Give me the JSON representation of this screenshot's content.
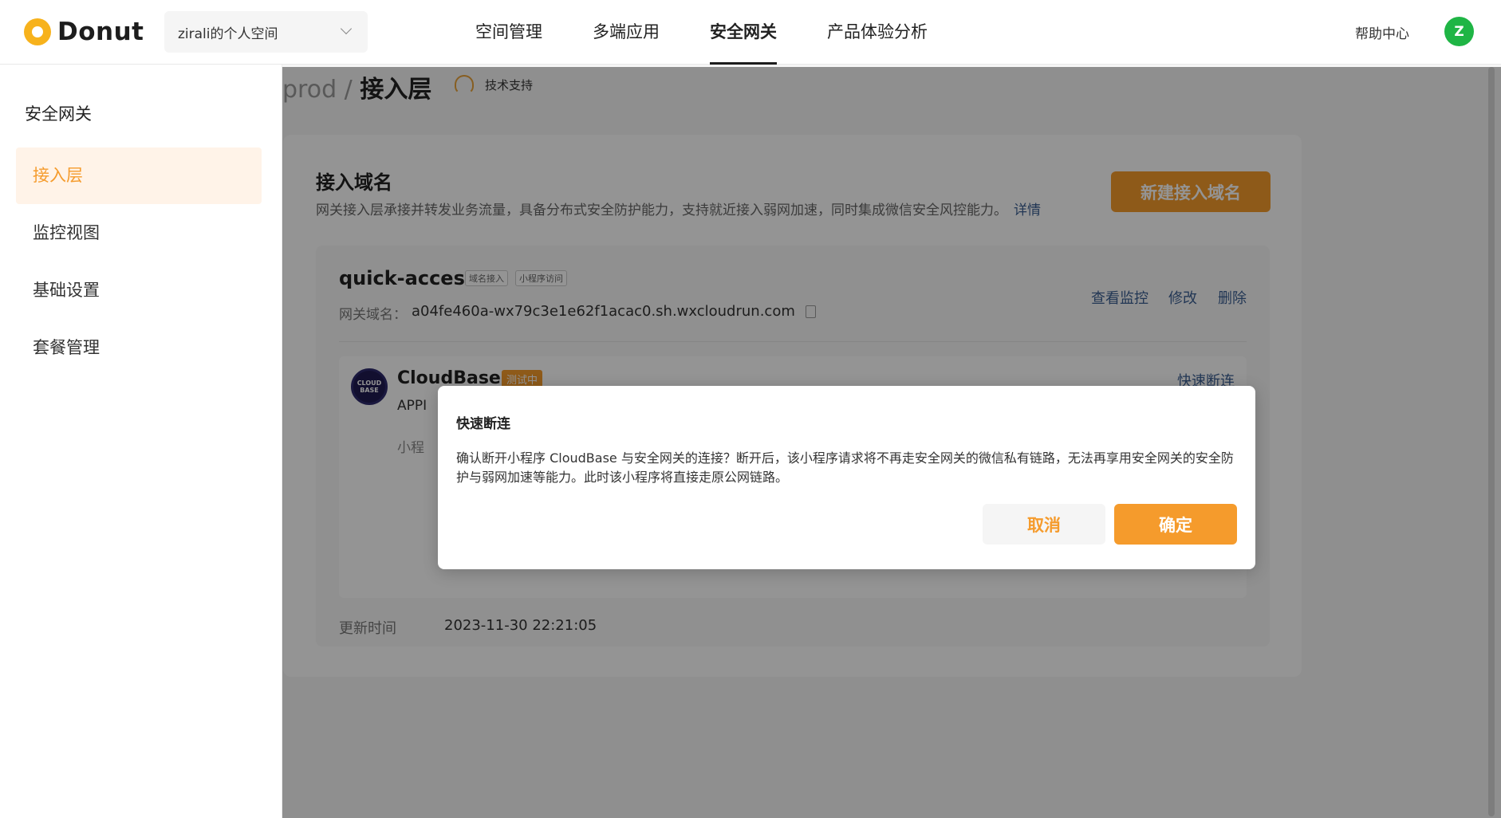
{
  "brand": {
    "name": "Donut",
    "accent": "#f59b2c"
  },
  "space_select": {
    "value": "zirali的个人空间"
  },
  "nav": {
    "items": [
      {
        "label": "空间管理"
      },
      {
        "label": "多端应用"
      },
      {
        "label": "安全网关"
      },
      {
        "label": "产品体验分析"
      }
    ],
    "active": "安全网关"
  },
  "header_right": {
    "help": "帮助中心",
    "avatar_initial": "Z"
  },
  "sidebar": {
    "title": "安全网关",
    "items": [
      {
        "label": "接入层"
      },
      {
        "label": "监控视图"
      },
      {
        "label": "基础设置"
      },
      {
        "label": "套餐管理"
      }
    ],
    "active": "接入层"
  },
  "breadcrumb": {
    "parent": "prod",
    "sep": "/",
    "current": "接入层"
  },
  "support": {
    "label": "技术支持"
  },
  "card": {
    "title": "接入域名",
    "desc": "网关接入层承接并转发业务流量，具备分布式安全防护能力，支持就近接入弱网加速，同时集成微信安全风控能力。",
    "detail_link": "详情",
    "new_button": "新建接入域名"
  },
  "domain": {
    "name": "quick-access",
    "tags": [
      "域名接入",
      "小程序访问"
    ],
    "gateway_label": "网关域名：",
    "gateway_value": "a04fe460a-wx79c3e1e62f1acac0.sh.wxcloudrun.com",
    "ops": [
      "查看监控",
      "修改",
      "删除"
    ],
    "app": {
      "logo_text": "CLOUD BASE",
      "name": "CloudBase",
      "status": "测试中",
      "sub": "APPI",
      "sub2": "小程",
      "quick_disconnect": "快速断连"
    },
    "update_label": "更新时间",
    "update_value": "2023-11-30 22:21:05"
  },
  "modal": {
    "title": "快速断连",
    "body": "确认断开小程序 CloudBase 与安全网关的连接？断开后，该小程序请求将不再走安全网关的微信私有链路，无法再享用安全网关的安全防护与弱网加速等能力。此时该小程序将直接走原公网链路。",
    "cancel": "取消",
    "confirm": "确定"
  }
}
